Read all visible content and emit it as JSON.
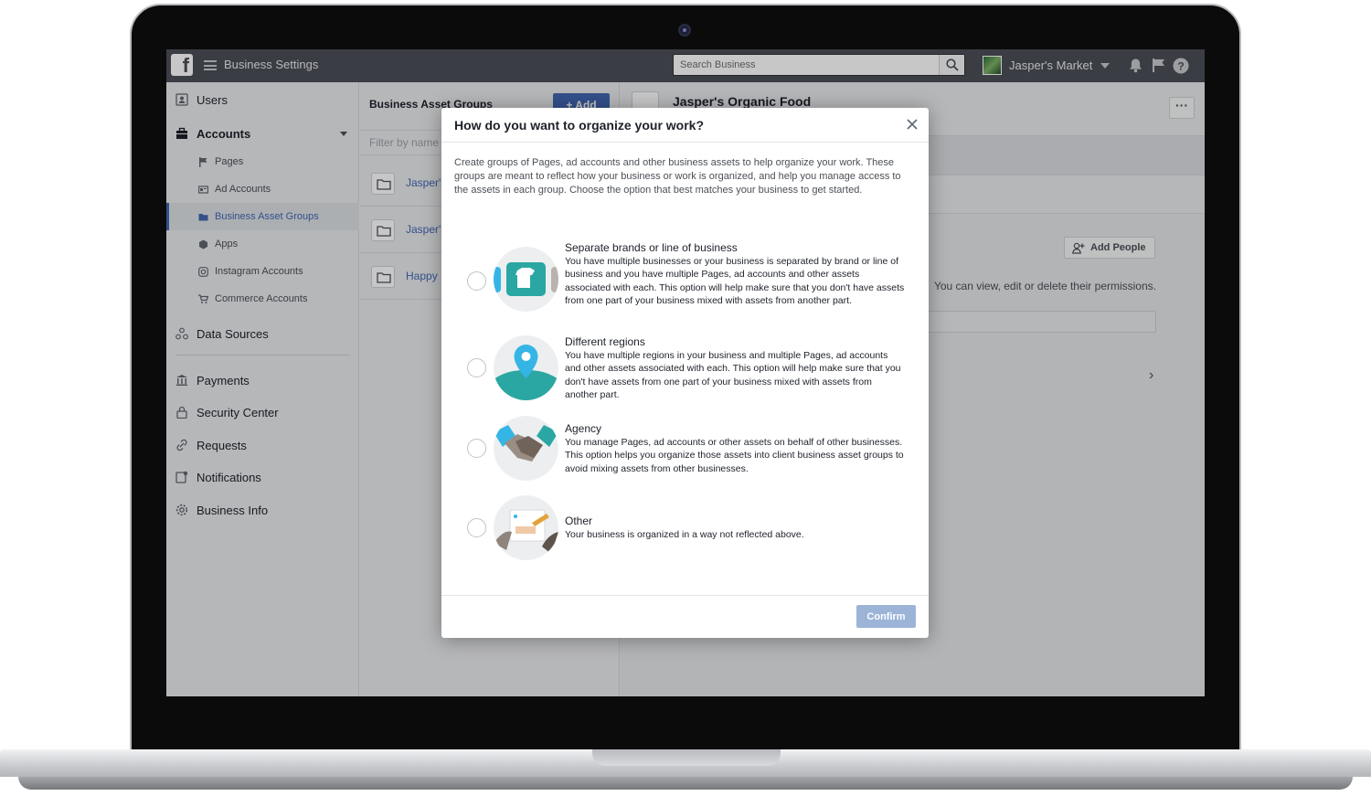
{
  "topbar": {
    "app_title": "Business Settings",
    "search_placeholder": "Search Business",
    "business_name": "Jasper's Market"
  },
  "sidebar": {
    "users": "Users",
    "accounts": "Accounts",
    "sub_items": [
      "Pages",
      "Ad Accounts",
      "Business Asset Groups",
      "Apps",
      "Instagram Accounts",
      "Commerce Accounts"
    ],
    "data_sources": "Data Sources",
    "payments": "Payments",
    "security_center": "Security Center",
    "requests": "Requests",
    "notifications": "Notifications",
    "business_info": "Business Info"
  },
  "middle": {
    "title": "Business Asset Groups",
    "add_label": "+ Add",
    "filter_placeholder": "Filter by name",
    "items": [
      "Jasper's",
      "Jasper's",
      "Happy"
    ]
  },
  "rightpanel": {
    "title": "Jasper's Organic Food",
    "more_label": "···",
    "add_people_label": "Add People",
    "hint_text": "You can view, edit or delete their permissions."
  },
  "modal": {
    "title": "How do you want to organize your work?",
    "intro": "Create groups of Pages, ad accounts and other business assets to help organize your work. These groups are meant to reflect how your business or work is organized, and help you manage access to the assets in each group. Choose the option that best matches your business to get started.",
    "options": [
      {
        "title": "Separate brands or line of business",
        "description": "You have multiple businesses or your business is separated by brand or line of business and you have multiple Pages, ad accounts and other assets associated with each. This option will help make sure that you don't have assets from one part of your business mixed with assets from another part."
      },
      {
        "title": "Different regions",
        "description": "You have multiple regions in your business and multiple Pages, ad accounts and other assets associated with each. This option will help make sure that you don't have assets from one part of your business mixed with assets from another part."
      },
      {
        "title": "Agency",
        "description": "You manage Pages, ad accounts or other assets on behalf of other businesses. This option helps you organize those assets into client business asset groups to avoid mixing assets from other businesses."
      },
      {
        "title": "Other",
        "description": "Your business is organized in a way not reflected above."
      }
    ],
    "confirm_label": "Confirm"
  },
  "colors": {
    "topbar": "#4b4f56",
    "brand_blue": "#4267b2",
    "confirm_disabled": "#9cb4d8",
    "teal": "#2ba7a3"
  }
}
